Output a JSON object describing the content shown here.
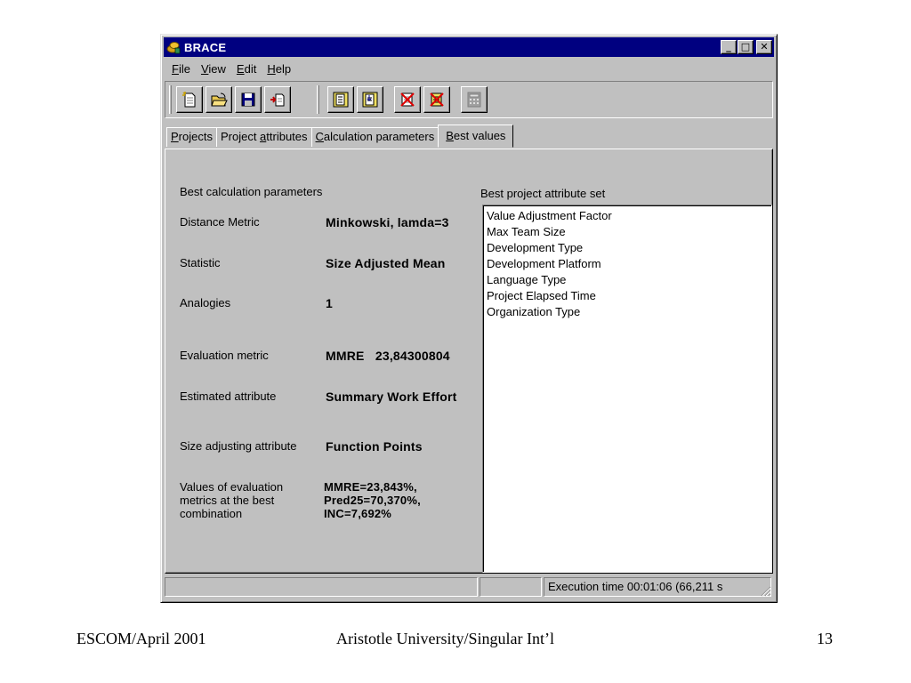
{
  "window": {
    "title": "BRACE",
    "controls": {
      "minimize": "_",
      "maximize": "□",
      "close": "✕"
    }
  },
  "menu": [
    {
      "pre": "",
      "u": "F",
      "post": "ile"
    },
    {
      "pre": "",
      "u": "V",
      "post": "iew"
    },
    {
      "pre": "",
      "u": "E",
      "post": "dit"
    },
    {
      "pre": "",
      "u": "H",
      "post": "elp"
    }
  ],
  "toolbar": {
    "icons": [
      "new-document-icon",
      "open-folder-icon",
      "save-disk-icon",
      "import-icon",
      "copy-sheet-icon",
      "paste-sheet-icon",
      "delete-red-x-icon",
      "delete-all-red-x-icon",
      "calculator-icon"
    ]
  },
  "tabs": [
    {
      "pre": "",
      "u": "P",
      "post": "rojects"
    },
    {
      "pre": "Project ",
      "u": "a",
      "post": "ttributes"
    },
    {
      "pre": "",
      "u": "C",
      "post": "alculation parameters"
    },
    {
      "pre": "",
      "u": "B",
      "post": "est values"
    }
  ],
  "panel": {
    "best_calc_heading": "Best calculation parameters",
    "best_attr_heading": "Best project attribute set",
    "rows": {
      "distance_label": "Distance Metric",
      "distance_value": "Minkowski, lamda=3",
      "statistic_label": "Statistic",
      "statistic_value": "Size Adjusted Mean",
      "analogies_label": "Analogies",
      "analogies_value": "1",
      "evaluation_label": "Evaluation metric",
      "evaluation_value": "MMRE   23,84300804",
      "estimated_label": "Estimated attribute",
      "estimated_value": "Summary Work Effort",
      "size_adj_label": "Size adjusting attribute",
      "size_adj_value": "Function Points",
      "values_label": "Values of evaluation\nmetrics at the best\ncombination",
      "values_value": "MMRE=23,843%,\nPred25=70,370%,\nINC=7,692%"
    },
    "attribute_list": [
      "Value Adjustment Factor",
      "Max Team Size",
      "Development Type",
      "Development Platform",
      "Language Type",
      "Project Elapsed Time",
      "Organization Type"
    ]
  },
  "status": {
    "panel1": "",
    "panel2": "",
    "panel3": "Execution time 00:01:06 (66,211 s"
  },
  "footer": {
    "left": "ESCOM/April 2001",
    "center": "Aristotle University/Singular Int’l",
    "right": "13"
  }
}
